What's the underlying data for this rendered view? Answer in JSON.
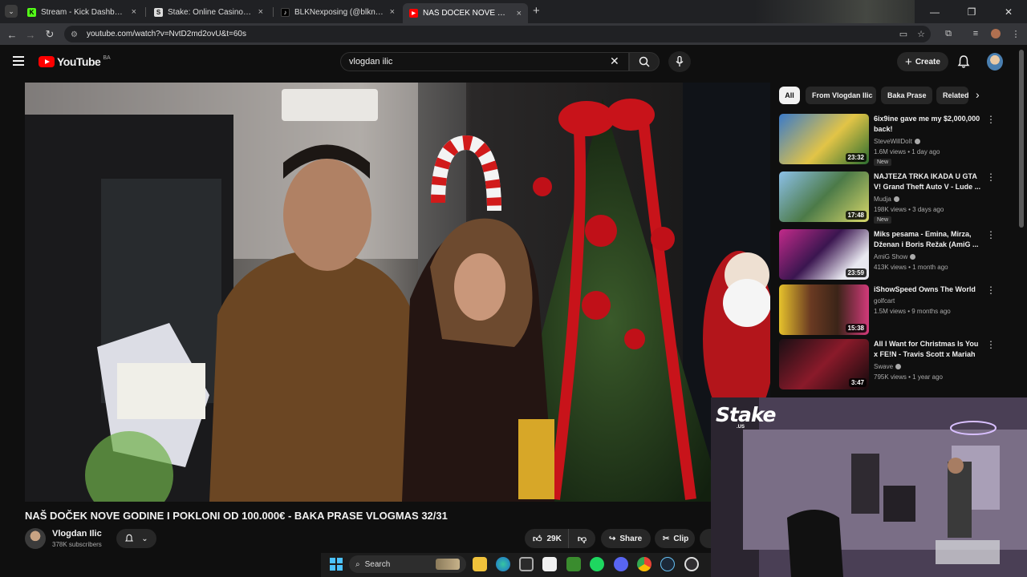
{
  "browser": {
    "tabs": [
      {
        "title": "Stream - Kick Dashboard",
        "favicon": "K"
      },
      {
        "title": "Stake: Online Casino & Sports",
        "favicon": "S"
      },
      {
        "title": "BLKNexposing (@blknexposing)",
        "favicon": "♪"
      },
      {
        "title": "NAŠ DOČEK NOVE GODINE I POKLONI",
        "favicon": "▶"
      }
    ],
    "new_tab": "+",
    "url": "youtube.com/watch?v=NvtD2md2ovU&t=60s"
  },
  "youtube": {
    "logo": "YouTube",
    "country_code": "BA",
    "search_value": "vlogdan ilic",
    "create_label": "Create"
  },
  "video": {
    "title": "NAŠ DOČEK NOVE GODINE I POKLONI OD 100.000€ - BAKA PRASE VLOGMAS 32/31",
    "channel": "Vlogdan Ilic",
    "subscribers": "378K subscribers",
    "likes": "29K",
    "share_label": "Share",
    "clip_label": "Clip"
  },
  "chips": [
    "All",
    "From Vlogdan Ilic",
    "Baka Prase",
    "Related"
  ],
  "recommendations": [
    {
      "title": "6ix9ine gave me my $2,000,000 back!",
      "channel": "SteveWillDoIt",
      "verified": true,
      "meta": "1.6M views • 1 day ago",
      "badge": "New",
      "duration": "23:32"
    },
    {
      "title": "NAJTEZA TRKA IKADA U GTA V! Grand Theft Auto V - Lude ...",
      "channel": "Mudja",
      "verified": true,
      "meta": "198K views • 3 days ago",
      "badge": "New",
      "duration": "17:48"
    },
    {
      "title": "Miks pesama - Emina, Mirza, Dženan i Boris Režak (AmiG ...",
      "channel": "AmiG Show",
      "verified": true,
      "meta": "413K views • 1 month ago",
      "badge": "",
      "duration": "23:59"
    },
    {
      "title": "iShowSpeed Owns The World",
      "channel": "golfcart",
      "verified": false,
      "meta": "1.5M views • 9 months ago",
      "badge": "",
      "duration": "15:38"
    },
    {
      "title": "All I Want for Christmas Is You x FE!N - Travis Scott x Mariah ...",
      "channel": "Swave",
      "verified": true,
      "meta": "795K views • 1 year ago",
      "badge": "",
      "duration": "3:47"
    }
  ],
  "overlay": {
    "brand": "Stake",
    "brand_sub": ".US"
  },
  "taskbar": {
    "search_label": "Search"
  }
}
